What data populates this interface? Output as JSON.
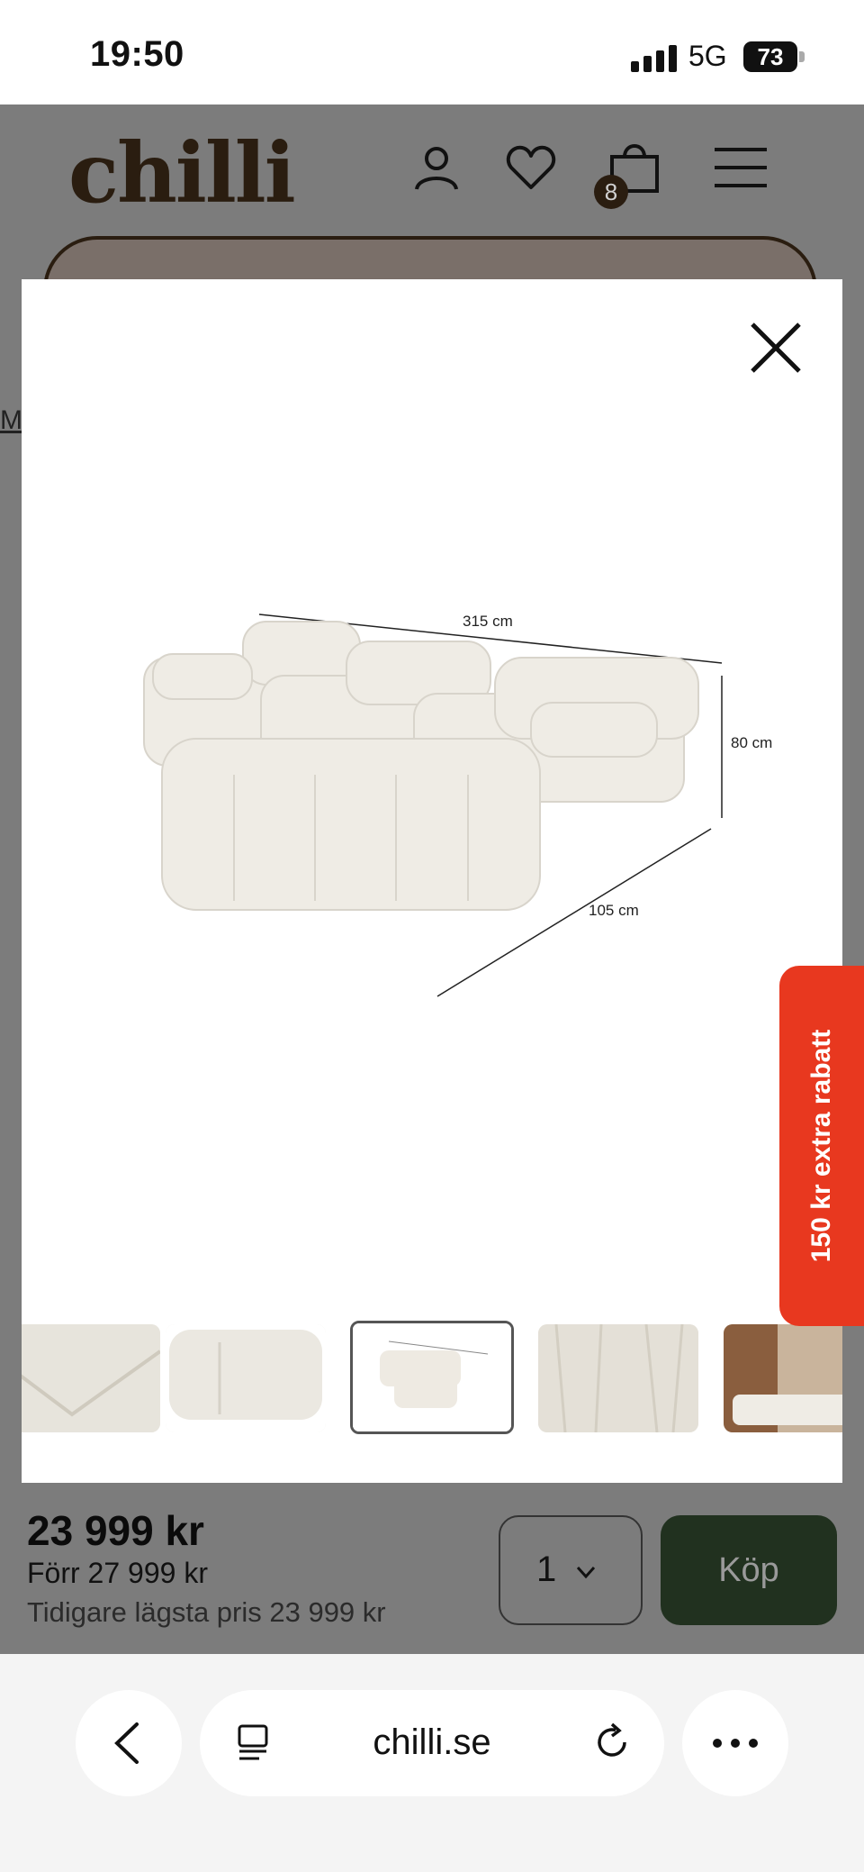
{
  "status_bar": {
    "time": "19:50",
    "network": "5G",
    "battery": "73"
  },
  "header": {
    "logo": "chilli",
    "icons": [
      "account-icon",
      "heart-icon",
      "cart-icon",
      "menu-icon"
    ],
    "cart_count": "8",
    "partial_link": "Mö"
  },
  "gallery": {
    "dimensions": {
      "width": "315 cm",
      "height": "80 cm",
      "depth": "105 cm"
    },
    "thumbnails": [
      "fabric-detail",
      "cushion-closeup",
      "dimensions-diagram",
      "fabric-texture",
      "room-scene"
    ],
    "selected_index": 2
  },
  "promo": {
    "label": "150 kr extra rabatt"
  },
  "purchase": {
    "price": "23 999 kr",
    "previous_price": "Förr 27 999 kr",
    "lowest_price": "Tidigare lägsta pris 23 999 kr",
    "quantity": "1",
    "buy_label": "Köp"
  },
  "browser": {
    "url": "chilli.se"
  },
  "colors": {
    "promo": "#e8381f",
    "buy_button": "#21311f",
    "brand": "#2a1d10",
    "overlay": "#7c7c7c"
  }
}
